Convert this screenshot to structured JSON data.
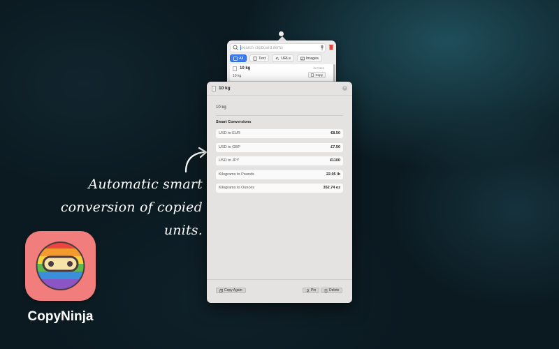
{
  "marketing": {
    "line1": "Automatic smart",
    "line2": "conversion of copied units."
  },
  "app": {
    "name": "CopyNinja"
  },
  "popover": {
    "search": {
      "placeholder": "Search clipboard items"
    },
    "filters": [
      {
        "label": "All",
        "icon": "grid-icon",
        "active": true
      },
      {
        "label": "Text",
        "icon": "text-icon",
        "active": false
      },
      {
        "label": "URLs",
        "icon": "link-icon",
        "active": false
      },
      {
        "label": "Images",
        "icon": "image-icon",
        "active": false
      }
    ],
    "clip": {
      "title": "10 kg",
      "time": "in 0 sec",
      "preview": "10 kg",
      "copy_label": "Copy"
    }
  },
  "detail": {
    "title": "10 kg",
    "content": "10 kg",
    "conversions_heading": "Smart Conversions",
    "conversions": [
      {
        "label": "USD to EUR",
        "value": "€8.50"
      },
      {
        "label": "USD to GBP",
        "value": "£7.50"
      },
      {
        "label": "USD to JPY",
        "value": "¥1100"
      },
      {
        "label": "Kilograms to Pounds",
        "value": "22.05 lb"
      },
      {
        "label": "Kilograms to Ounces",
        "value": "352.74 oz"
      }
    ],
    "buttons": {
      "copy_again": "Copy Again",
      "pin": "Pin",
      "delete": "Delete"
    }
  },
  "colors": {
    "accent": "#3a7bf0",
    "app_icon_bg": "#f17d7d",
    "trash_red": "#e0463c"
  }
}
